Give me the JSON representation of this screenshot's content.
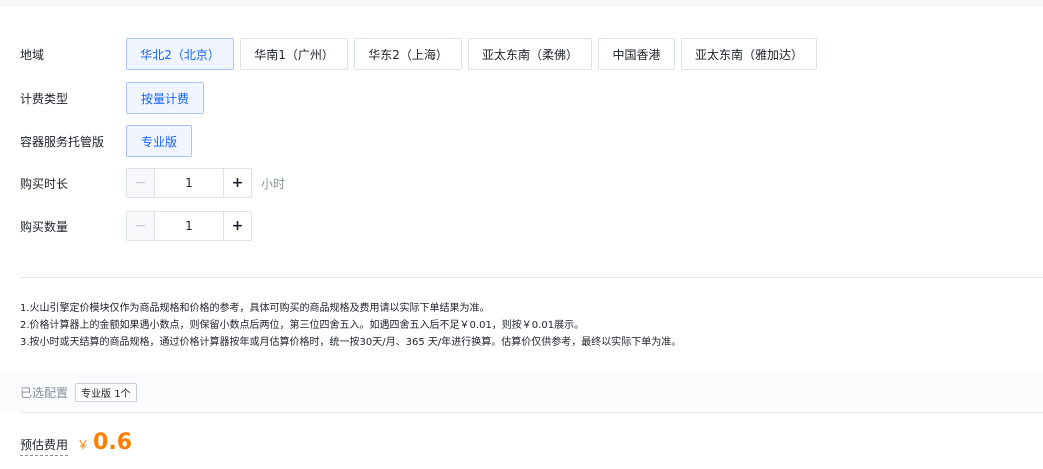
{
  "form": {
    "region": {
      "label": "地域",
      "options": [
        "华北2（北京）",
        "华南1（广州）",
        "华东2（上海）",
        "亚太东南（柔佛）",
        "中国香港",
        "亚太东南（雅加达）"
      ],
      "selected": "华北2（北京）"
    },
    "billing": {
      "label": "计费类型",
      "options": [
        "按量计费"
      ],
      "selected": "按量计费"
    },
    "edition": {
      "label": "容器服务托管版",
      "options": [
        "专业版"
      ],
      "selected": "专业版"
    },
    "duration": {
      "label": "购买时长",
      "value": "1",
      "unit": "小时",
      "minus": "−",
      "plus": "+"
    },
    "quantity": {
      "label": "购买数量",
      "value": "1",
      "minus": "−",
      "plus": "+"
    }
  },
  "notes": [
    "1.火山引擎定价模块仅作为商品规格和价格的参考，具体可购买的商品规格及费用请以实际下单结果为准。",
    "2.价格计算器上的金额如果遇小数点，则保留小数点后两位，第三位四舍五入。如遇四舍五入后不足￥0.01，则按￥0.01展示。",
    "3.按小时或天结算的商品规格，通过价格计算器按年或月估算价格时，统一按30天/月、365 天/年进行换算。估算价仅供参考，最终以实际下单为准。"
  ],
  "selected_config": {
    "label": "已选配置",
    "tag": "专业版 1个"
  },
  "price": {
    "label": "预估费用",
    "symbol": "￥",
    "value": "0.6"
  },
  "colors": {
    "accent": "#1664ff",
    "price": "#ff7d00"
  }
}
